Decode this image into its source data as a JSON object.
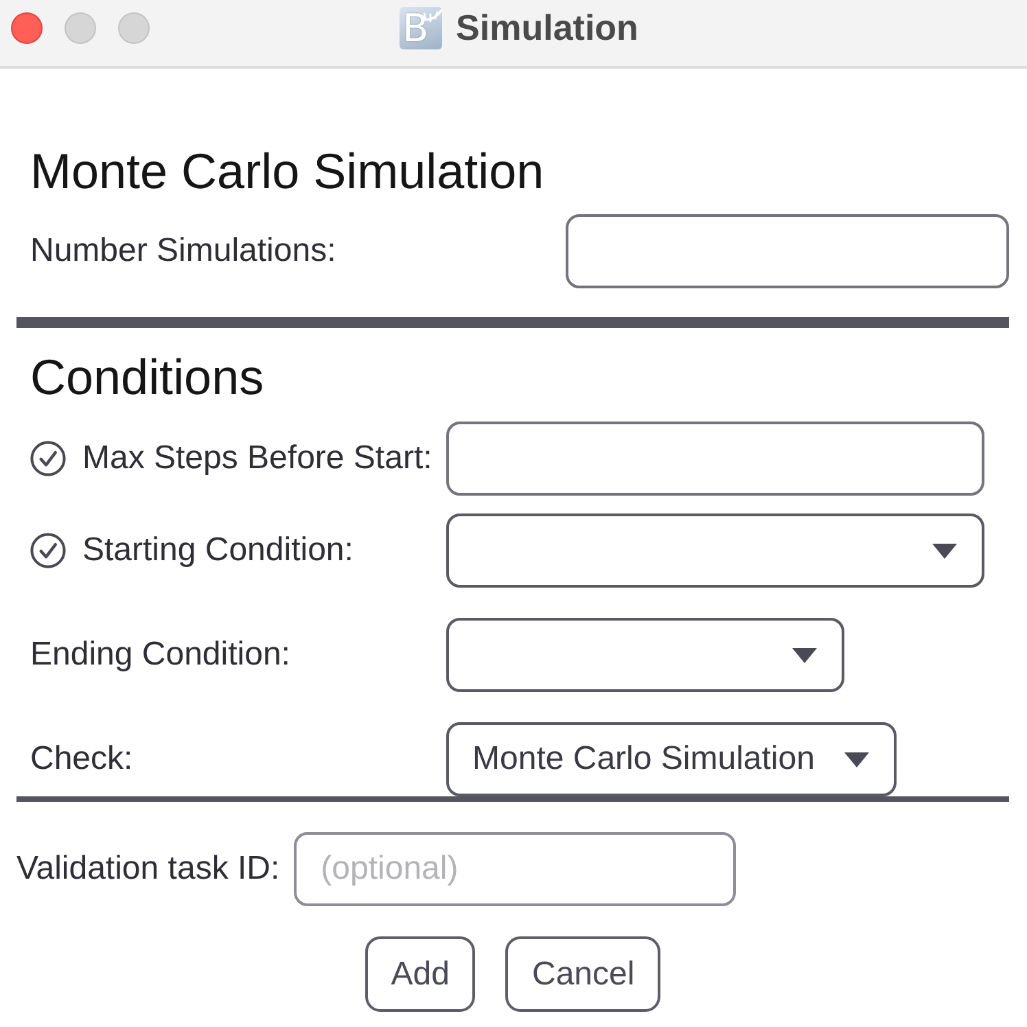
{
  "window": {
    "title": "Simulation",
    "icon_letter": "B",
    "controls": [
      {
        "kind": "close",
        "disabled": false
      },
      {
        "kind": "minimize",
        "disabled": true
      },
      {
        "kind": "zoom",
        "disabled": true
      }
    ]
  },
  "sections": [
    {
      "heading": "Monte Carlo Simulation",
      "rows": [
        {
          "kind": "text",
          "label": "Number Simulations:"
        }
      ]
    },
    {
      "heading": "Conditions",
      "rows": [
        {
          "kind": "text",
          "label": "Max Steps Before Start:",
          "checked": true
        },
        {
          "kind": "dropdown",
          "label": "Starting Condition:",
          "checked": true
        },
        {
          "kind": "dropdown",
          "label": "Ending Condition:"
        },
        {
          "kind": "dropdown",
          "label": "Check:",
          "value": "Monte Carlo Simulation"
        }
      ]
    }
  ],
  "validation": {
    "label": "Validation task ID:",
    "placeholder": "(optional)"
  },
  "buttons": [
    {
      "label": "Add"
    },
    {
      "label": "Cancel"
    }
  ]
}
